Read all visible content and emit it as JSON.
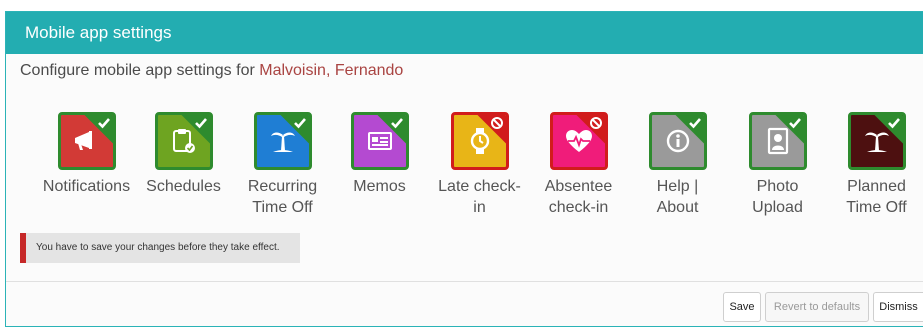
{
  "dialog": {
    "title": "Mobile app settings",
    "subtitle_prefix": "Configure mobile app settings for ",
    "user_name": "Malvoisin, Fernando"
  },
  "features": [
    {
      "label_line1": "Notifications",
      "label_line2": "",
      "icon": "megaphone-icon",
      "color": "#d23a36",
      "enabled": true
    },
    {
      "label_line1": "Schedules",
      "label_line2": "",
      "icon": "clipboard-check-icon",
      "color": "#6ea421",
      "enabled": true
    },
    {
      "label_line1": "Recurring",
      "label_line2": "Time Off",
      "icon": "palm-tree-icon",
      "color": "#1f7ed4",
      "enabled": true
    },
    {
      "label_line1": "Memos",
      "label_line2": "",
      "icon": "memo-icon",
      "color": "#b44ad1",
      "enabled": true
    },
    {
      "label_line1": "Late check-",
      "label_line2": "in",
      "icon": "watch-icon",
      "color": "#e8b517",
      "enabled": false
    },
    {
      "label_line1": "Absentee",
      "label_line2": "check-in",
      "icon": "heartbeat-icon",
      "color": "#f01c7a",
      "enabled": false
    },
    {
      "label_line1": "Help |",
      "label_line2": "About",
      "icon": "info-icon",
      "color": "#9a9a9a",
      "enabled": true
    },
    {
      "label_line1": "Photo",
      "label_line2": "Upload",
      "icon": "portrait-photo-icon",
      "color": "#9a9a9a",
      "enabled": true
    },
    {
      "label_line1": "Planned",
      "label_line2": "Time Off",
      "icon": "palm-tree-icon",
      "color": "#4d1010",
      "enabled": true
    }
  ],
  "warning": {
    "text": "You have to save your changes before they take effect."
  },
  "buttons": {
    "save": "Save",
    "revert": "Revert to defaults",
    "dismiss": "Dismiss"
  }
}
